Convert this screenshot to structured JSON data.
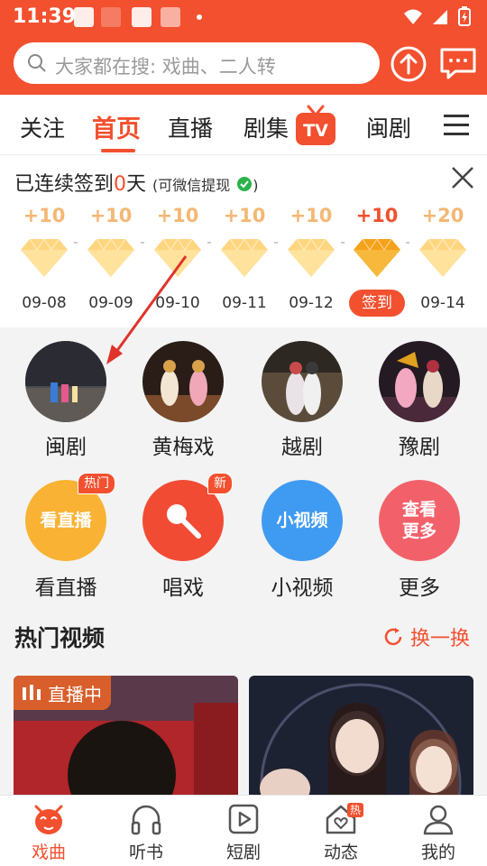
{
  "status_bar": {
    "time": "11:39"
  },
  "search": {
    "placeholder": "大家都在搜: 戏曲、二人转"
  },
  "tabs": [
    {
      "label": "关注",
      "active": false
    },
    {
      "label": "首页",
      "active": true
    },
    {
      "label": "直播",
      "active": false
    },
    {
      "label": "剧集",
      "active": false,
      "badge": "TV"
    },
    {
      "label": "闽剧",
      "active": false
    }
  ],
  "checkin": {
    "title_prefix": "已连续签到",
    "days_count": "0",
    "title_suffix": "天",
    "note": "(可微信提现",
    "days": [
      {
        "points": "+10",
        "date": "09-08"
      },
      {
        "points": "+10",
        "date": "09-09"
      },
      {
        "points": "+10",
        "date": "09-10"
      },
      {
        "points": "+10",
        "date": "09-11"
      },
      {
        "points": "+10",
        "date": "09-12"
      },
      {
        "points": "+10",
        "date": "签到",
        "today": true
      },
      {
        "points": "+20",
        "date": "09-14"
      }
    ]
  },
  "categories": [
    {
      "label": "闽剧"
    },
    {
      "label": "黄梅戏"
    },
    {
      "label": "越剧"
    },
    {
      "label": "豫剧"
    }
  ],
  "features": [
    {
      "label": "看直播",
      "icon_text": "看直播",
      "badge": "热门",
      "color": "#f9b233"
    },
    {
      "label": "唱戏",
      "icon_text": "",
      "badge": "新",
      "color": "#f24b34"
    },
    {
      "label": "小视频",
      "icon_text": "小视频",
      "badge": "",
      "color": "#3f9af1"
    },
    {
      "label": "更多",
      "icon_text": "查看更多",
      "badge": "",
      "color": "#f2616a"
    }
  ],
  "hot_videos": {
    "title": "热门视频",
    "refresh_label": "换一换",
    "live_label": "直播中"
  },
  "bottom_nav": [
    {
      "label": "戏曲",
      "icon": "opera-mask-icon",
      "active": true
    },
    {
      "label": "听书",
      "icon": "headphones-icon",
      "active": false
    },
    {
      "label": "短剧",
      "icon": "play-icon",
      "active": false
    },
    {
      "label": "动态",
      "icon": "house-heart-icon",
      "active": false,
      "badge": "热"
    },
    {
      "label": "我的",
      "icon": "person-icon",
      "active": false
    }
  ],
  "colors": {
    "accent": "#f2502f",
    "gold": "#f4b774"
  }
}
